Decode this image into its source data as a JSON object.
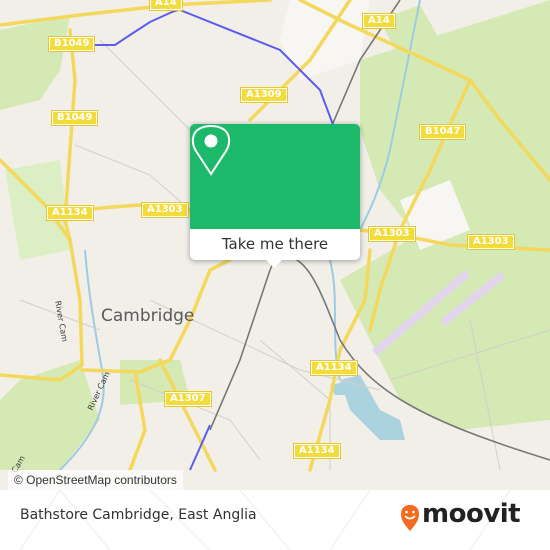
{
  "map": {
    "city_label": "Cambridge",
    "river_labels": [
      "River Cam",
      "River Cam",
      "Cam"
    ],
    "road_labels": [
      {
        "id": "a14-north",
        "text": "A14"
      },
      {
        "id": "a14-east",
        "text": "A14"
      },
      {
        "id": "b1049-top",
        "text": "B1049"
      },
      {
        "id": "b1049-mid",
        "text": "B1049"
      },
      {
        "id": "a1309",
        "text": "A1309"
      },
      {
        "id": "b1047",
        "text": "B1047"
      },
      {
        "id": "a1134-west",
        "text": "A1134"
      },
      {
        "id": "a1303-west",
        "text": "A1303"
      },
      {
        "id": "a1303-mid",
        "text": "A1303"
      },
      {
        "id": "a1303-east",
        "text": "A1303"
      },
      {
        "id": "a1307",
        "text": "A1307"
      },
      {
        "id": "a1134-mid",
        "text": "A1134"
      },
      {
        "id": "a1134-south",
        "text": "A1134"
      }
    ],
    "attribution": "© OpenStreetMap contributors",
    "colors": {
      "land": "#f2efe9",
      "green": "#cde6a8",
      "water": "#aad3df",
      "road": "#f7df5f",
      "rail": "#707070",
      "route": "#5b5bf0"
    }
  },
  "popup": {
    "icon": "map-pin-icon",
    "button_label": "Take me there",
    "color": "#1db96b"
  },
  "footer": {
    "place_title": "Bathstore Cambridge, East Anglia",
    "logo_text": "moovit",
    "logo_icon": "moovit-smile-pin-icon",
    "logo_color": "#f26b21"
  }
}
